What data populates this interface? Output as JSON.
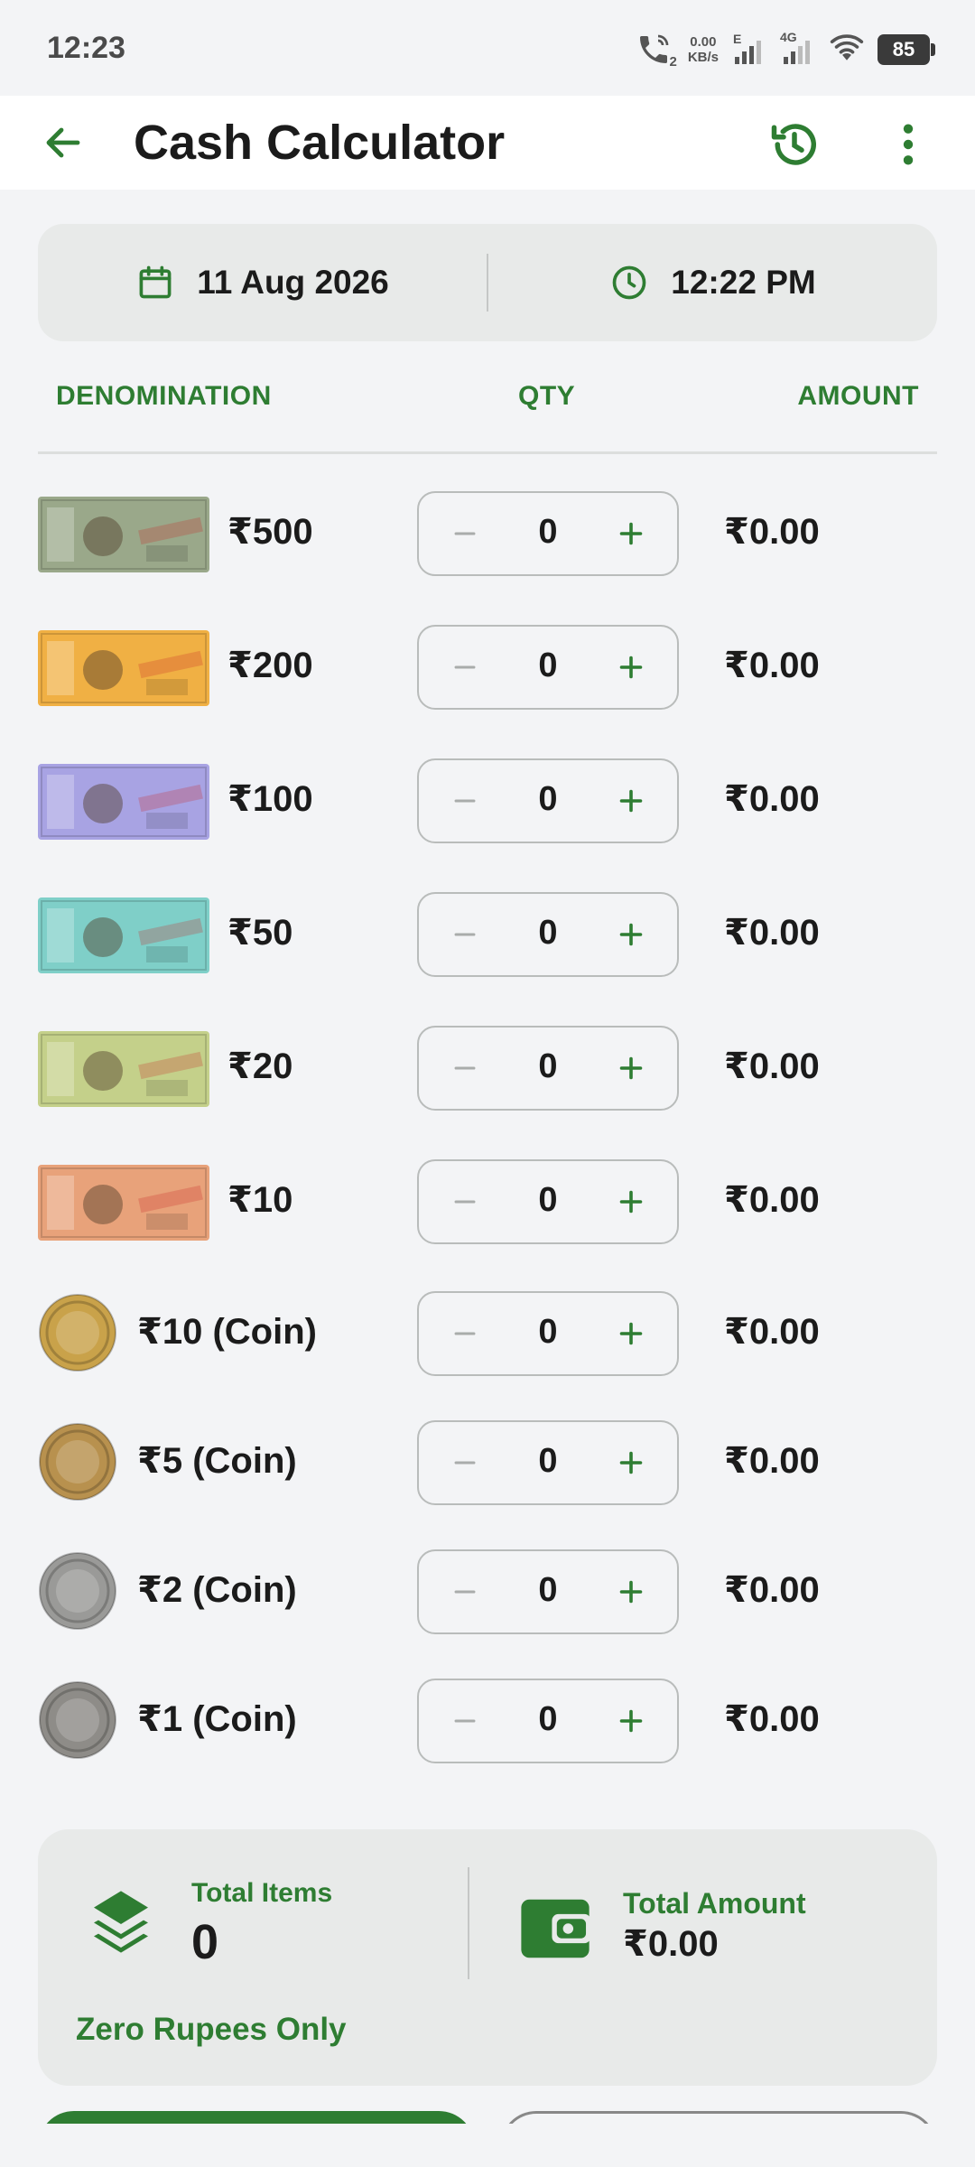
{
  "status_bar": {
    "time": "12:23",
    "call_sim": "2",
    "net_speed_value": "0.00",
    "net_speed_unit": "KB/s",
    "sim1_type": "E",
    "sim2_type": "4G",
    "battery": "85"
  },
  "app_bar": {
    "title": "Cash Calculator",
    "icons": [
      "back-arrow",
      "history",
      "more-vertical"
    ]
  },
  "datetime": {
    "date": "11 Aug 2026",
    "time": "12:22 PM"
  },
  "columns": {
    "denomination": "DENOMINATION",
    "qty": "QTY",
    "amount": "AMOUNT"
  },
  "rows": [
    {
      "label": "₹500",
      "qty": "0",
      "amount": "₹0.00",
      "kind": "note",
      "color": "#9aa88a"
    },
    {
      "label": "₹200",
      "qty": "0",
      "amount": "₹0.00",
      "kind": "note",
      "color": "#f0b044"
    },
    {
      "label": "₹100",
      "qty": "0",
      "amount": "₹0.00",
      "kind": "note",
      "color": "#a8a3e3"
    },
    {
      "label": "₹50",
      "qty": "0",
      "amount": "₹0.00",
      "kind": "note",
      "color": "#7fcfc8"
    },
    {
      "label": "₹20",
      "qty": "0",
      "amount": "₹0.00",
      "kind": "note",
      "color": "#c4d08a"
    },
    {
      "label": "₹10",
      "qty": "0",
      "amount": "₹0.00",
      "kind": "note",
      "color": "#e8a27a"
    },
    {
      "label": "₹10 (Coin)",
      "qty": "0",
      "amount": "₹0.00",
      "kind": "coin",
      "color": "#c9a24a"
    },
    {
      "label": "₹5 (Coin)",
      "qty": "0",
      "amount": "₹0.00",
      "kind": "coin",
      "color": "#b8914e"
    },
    {
      "label": "₹2 (Coin)",
      "qty": "0",
      "amount": "₹0.00",
      "kind": "coin",
      "color": "#9a9a98"
    },
    {
      "label": "₹1 (Coin)",
      "qty": "0",
      "amount": "₹0.00",
      "kind": "coin",
      "color": "#8e8c88"
    }
  ],
  "summary": {
    "total_items_label": "Total Items",
    "total_items_value": "0",
    "total_amount_label": "Total Amount",
    "total_amount_value": "₹0.00",
    "amount_in_words": "Zero Rupees Only"
  },
  "colors": {
    "accent": "#2e7d32",
    "background": "#f3f4f6",
    "card": "#e8eae9"
  }
}
